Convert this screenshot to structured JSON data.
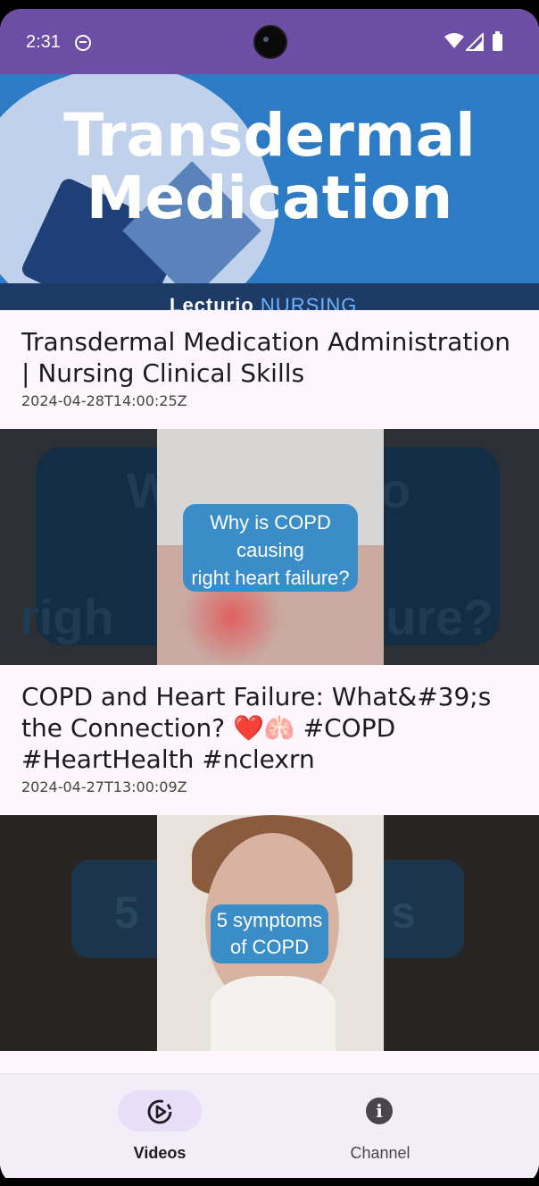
{
  "status_bar": {
    "time": "2:31"
  },
  "videos": [
    {
      "thumbnail_text": [
        "Transdermal",
        "Medication"
      ],
      "thumbnail_brand": "Lecturio",
      "thumbnail_brand_suffix": "NURSING",
      "title": "Transdermal Medication Administration | Nursing Clinical Skills",
      "date": "2024-04-28T14:00:25Z"
    },
    {
      "thumbnail_text": [
        "Why is COPD",
        "causing",
        "right heart failure?"
      ],
      "thumbnail_bg_left": "W",
      "thumbnail_bg_left2": "righ",
      "thumbnail_bg_right": "o",
      "thumbnail_bg_right2": "ure?",
      "title": "COPD and Heart Failure: What&#39;s the Connection? ❤️🫁 #COPD #HeartHealth #nclexrn",
      "date": "2024-04-27T13:00:09Z"
    },
    {
      "thumbnail_text": [
        "5 symptoms",
        "of COPD"
      ],
      "thumbnail_bg_left": "5",
      "thumbnail_bg_right": "s"
    }
  ],
  "bottom_nav": {
    "items": [
      {
        "label": "Videos",
        "icon": "play-circle-icon",
        "active": true
      },
      {
        "label": "Channel",
        "icon": "info-icon",
        "active": false
      }
    ]
  },
  "colors": {
    "status_bar": "#6c4ea4",
    "nav_indicator": "#e8def8",
    "thumbnail_bubble": "#3a8dc7"
  }
}
